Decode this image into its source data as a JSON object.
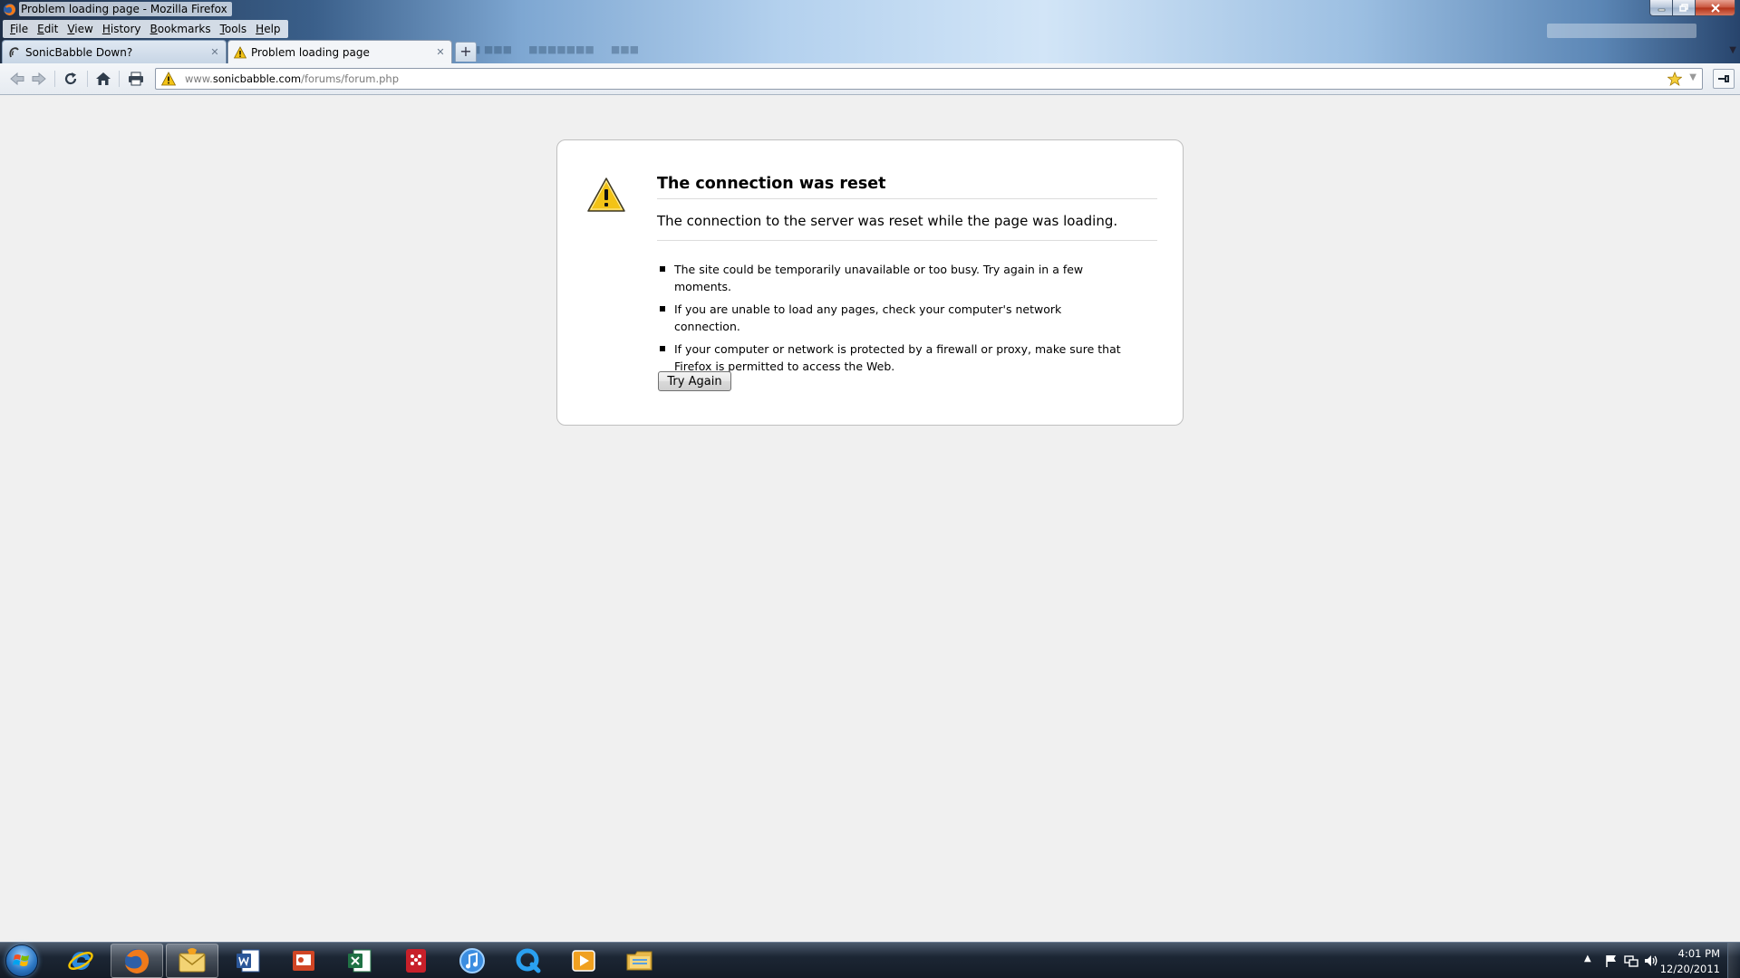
{
  "window": {
    "title": "Problem loading page - Mozilla Firefox"
  },
  "menu": [
    "File",
    "Edit",
    "View",
    "History",
    "Bookmarks",
    "Tools",
    "Help"
  ],
  "tabs": [
    {
      "label": "SonicBabble Down?",
      "active": false
    },
    {
      "label": "Problem loading page",
      "active": true
    }
  ],
  "navbar": {
    "url_prefix": "www.",
    "url_domain": "sonicbabble.com",
    "url_path": "/forums/forum.php"
  },
  "error": {
    "title": "The connection was reset",
    "description": "The connection to the server was reset while the page was loading.",
    "bullets": [
      "The site could be temporarily unavailable or too busy. Try again in a few moments.",
      "If you are unable to load any pages, check your computer's network connection.",
      "If your computer or network is protected by a firewall or proxy, make sure that Firefox is permitted to access the Web."
    ],
    "button_label": "Try Again"
  },
  "taskbar": {
    "apps": [
      "internet-explorer-icon",
      "firefox-icon",
      "outlook-mail-icon",
      "word-icon",
      "powerpoint-icon",
      "excel-icon",
      "unknown-red-app-icon",
      "itunes-icon",
      "quicktime-icon",
      "media-player-icon",
      "file-explorer-icon"
    ],
    "clock_time": "4:01 PM",
    "clock_date": "12/20/2011"
  },
  "colors": {
    "page_background": "#f0f0f0",
    "warning_yellow": "#f3c316",
    "taskbar": "#1c2634"
  }
}
